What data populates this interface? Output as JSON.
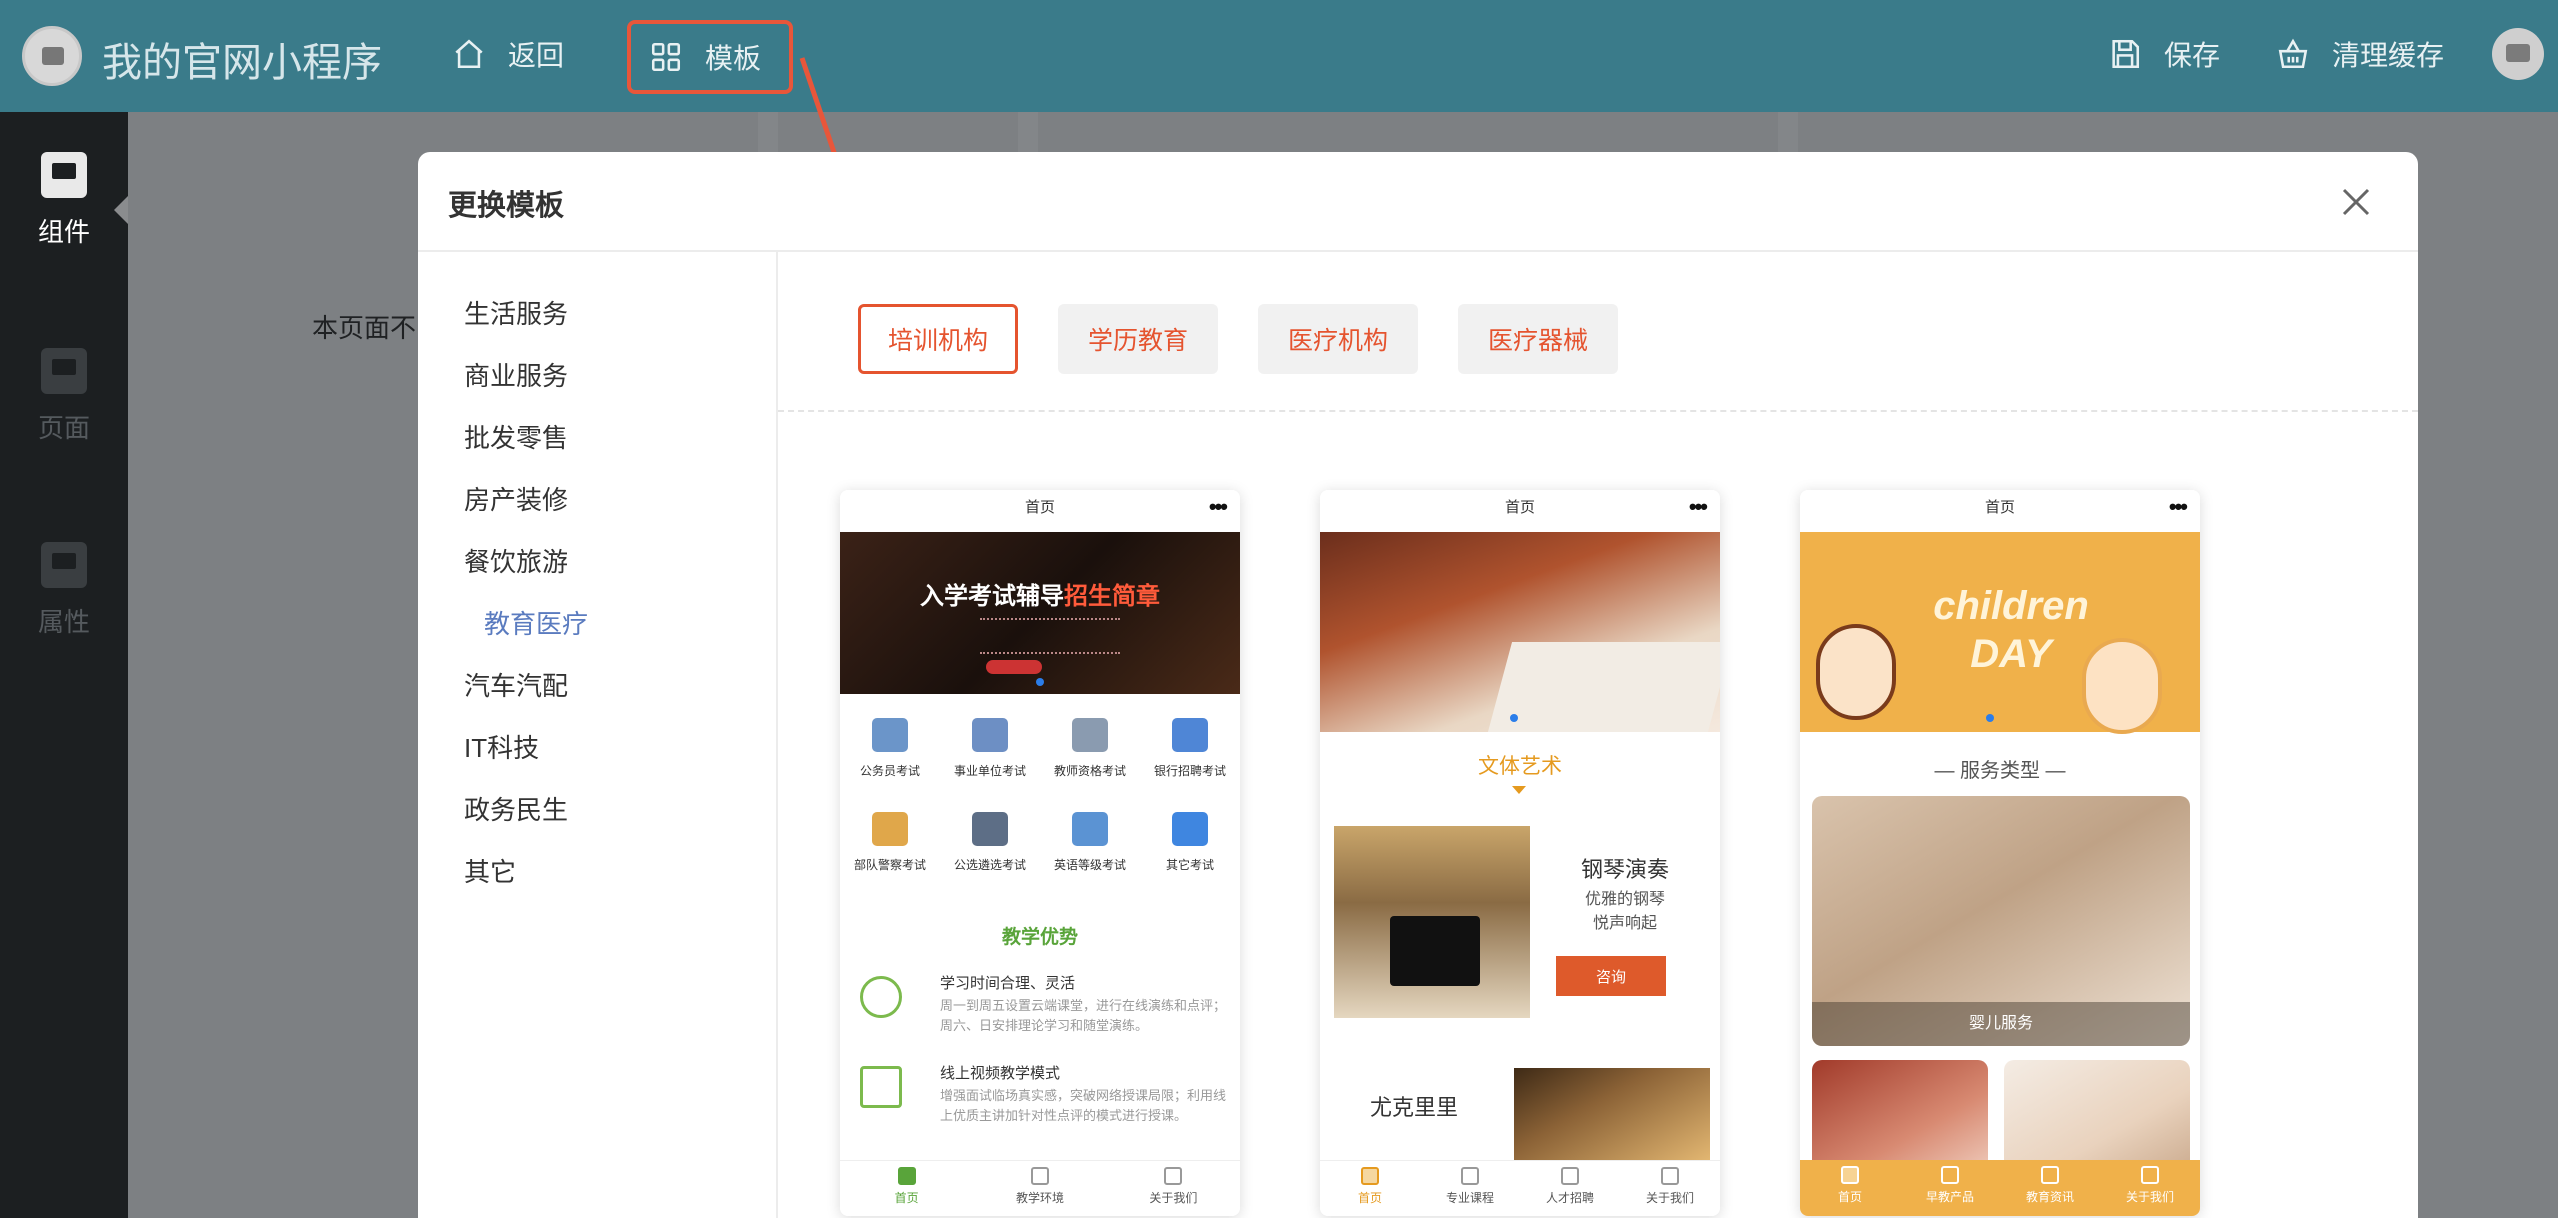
{
  "app": {
    "title": "我的官网小程序"
  },
  "toolbar": {
    "back_label": "返回",
    "template_label": "模板",
    "save_label": "保存",
    "clear_cache_label": "清理缓存"
  },
  "sidebar": {
    "items": [
      {
        "label": "组件",
        "active": true
      },
      {
        "label": "页面",
        "active": false
      },
      {
        "label": "属性",
        "active": false
      }
    ]
  },
  "background": {
    "text": "本页面不"
  },
  "modal": {
    "title": "更换模板",
    "categories": [
      {
        "label": "生活服务"
      },
      {
        "label": "商业服务"
      },
      {
        "label": "批发零售"
      },
      {
        "label": "房产装修"
      },
      {
        "label": "餐饮旅游"
      },
      {
        "label": "教育医疗",
        "active": true
      },
      {
        "label": "汽车汽配"
      },
      {
        "label": "IT科技"
      },
      {
        "label": "政务民生"
      },
      {
        "label": "其它"
      }
    ],
    "tabs": [
      {
        "label": "培训机构",
        "active": true
      },
      {
        "label": "学历教育"
      },
      {
        "label": "医疗机构"
      },
      {
        "label": "医疗器械"
      }
    ],
    "previews": [
      {
        "page_title": "首页",
        "banner_text": "入学考试辅导",
        "banner_text_highlight": "招生简章",
        "grid": [
          {
            "label": "公务员考试",
            "color": "#6b95c9"
          },
          {
            "label": "事业单位考试",
            "color": "#6d8fc4"
          },
          {
            "label": "教师资格考试",
            "color": "#8a9bb0"
          },
          {
            "label": "银行招聘考试",
            "color": "#4f86d6"
          },
          {
            "label": "部队警察考试",
            "color": "#e0a74a"
          },
          {
            "label": "公选遴选考试",
            "color": "#5d6e86"
          },
          {
            "label": "英语等级考试",
            "color": "#5b93d3"
          },
          {
            "label": "其它考试",
            "color": "#3f86e0"
          }
        ],
        "section_title": "教学优势",
        "advantages": [
          {
            "title": "学习时间合理、灵活",
            "desc": "周一到周五设置云端课堂，进行在线演练和点评；周六、日安排理论学习和随堂演练。"
          },
          {
            "title": "线上视频教学模式",
            "desc": "增强面试临场真实感，突破网络授课局限；利用线上优质主讲加针对性点评的模式进行授课。"
          }
        ],
        "tabbar": [
          "首页",
          "教学环境",
          "关于我们"
        ]
      },
      {
        "page_title": "首页",
        "section_title": "文体艺术",
        "item_title": "钢琴演奏",
        "item_desc_1": "优雅的钢琴",
        "item_desc_2": "悦声响起",
        "button_label": "咨询",
        "item2_title": "尤克里里",
        "tabbar": [
          "首页",
          "专业课程",
          "人才招聘",
          "关于我们"
        ]
      },
      {
        "page_title": "首页",
        "banner_text": "children DAY",
        "section_title": "服务类型",
        "caption": "婴儿服务",
        "tabbar": [
          "首页",
          "早教产品",
          "教育资讯",
          "关于我们"
        ]
      }
    ]
  },
  "colors": {
    "topbar": "#3a7b8a",
    "accent": "#e5542f",
    "highlight_border": "#e8563a",
    "sidebar": "#1c1f21",
    "active_category": "#5a7bbf"
  },
  "icons": {
    "back": "home-icon",
    "template": "grid-icon",
    "save": "save-icon",
    "clear": "basket-icon",
    "close": "close-icon"
  }
}
